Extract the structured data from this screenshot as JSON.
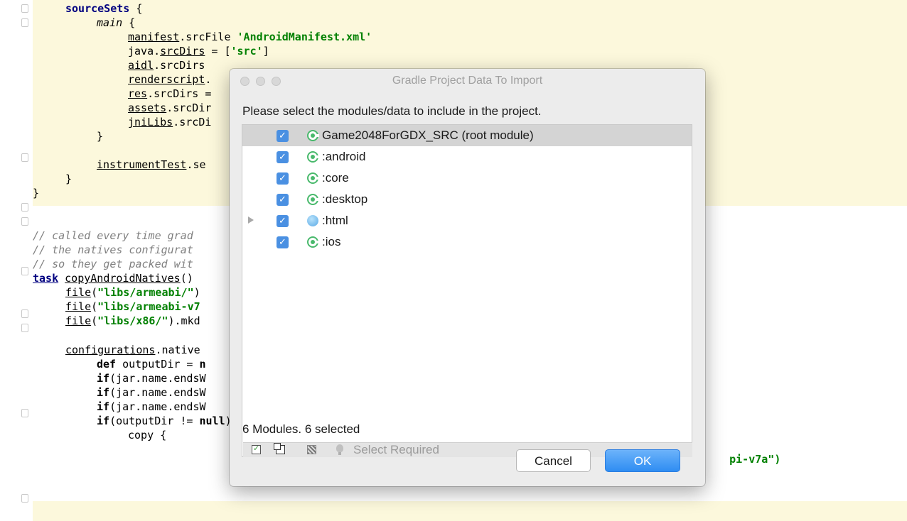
{
  "editor": {
    "lines": [
      {
        "segs": [
          {
            "t": "sourceSets",
            "c": "kw"
          },
          {
            "t": " {",
            "c": ""
          }
        ]
      },
      {
        "segs": [
          {
            "t": "main",
            "c": "it"
          },
          {
            "t": " {",
            "c": ""
          }
        ]
      },
      {
        "segs": [
          {
            "t": "manifest",
            "c": "ul"
          },
          {
            "t": ".srcFile ",
            "c": ""
          },
          {
            "t": "'AndroidManifest.xml'",
            "c": "str"
          }
        ]
      },
      {
        "segs": [
          {
            "t": "java.",
            "c": ""
          },
          {
            "t": "srcDirs",
            "c": "ul"
          },
          {
            "t": " = [",
            "c": ""
          },
          {
            "t": "'src'",
            "c": "str"
          },
          {
            "t": "]",
            "c": ""
          }
        ]
      },
      {
        "segs": [
          {
            "t": "aidl",
            "c": "ul"
          },
          {
            "t": ".srcDirs",
            "c": ""
          }
        ]
      },
      {
        "segs": [
          {
            "t": "renderscript",
            "c": "ul"
          },
          {
            "t": ".",
            "c": ""
          }
        ]
      },
      {
        "segs": [
          {
            "t": "res",
            "c": "ul"
          },
          {
            "t": ".srcDirs =",
            "c": ""
          }
        ]
      },
      {
        "segs": [
          {
            "t": "assets",
            "c": "ul"
          },
          {
            "t": ".srcDir",
            "c": ""
          }
        ]
      },
      {
        "segs": [
          {
            "t": "jniLibs",
            "c": "ul"
          },
          {
            "t": ".srcDi",
            "c": ""
          }
        ]
      },
      {
        "segs": [
          {
            "t": "}",
            "c": ""
          }
        ]
      },
      {
        "segs": []
      },
      {
        "segs": [
          {
            "t": "instrumentTest",
            "c": "ul"
          },
          {
            "t": ".se",
            "c": ""
          }
        ]
      },
      {
        "segs": [
          {
            "t": "}",
            "c": ""
          }
        ]
      },
      {
        "segs": [
          {
            "t": "}",
            "c": ""
          }
        ]
      },
      {
        "segs": []
      },
      {
        "segs": []
      },
      {
        "segs": [
          {
            "t": "// called every time grad",
            "c": "cm"
          }
        ]
      },
      {
        "segs": [
          {
            "t": "// the natives configurat",
            "c": "cm"
          }
        ]
      },
      {
        "segs": [
          {
            "t": "// so they get packed wit",
            "c": "cm"
          }
        ]
      },
      {
        "segs": [
          {
            "t": "task",
            "c": "kw ul"
          },
          {
            "t": " ",
            "c": ""
          },
          {
            "t": "copyAndroidNatives",
            "c": "ul"
          },
          {
            "t": "()",
            "c": ""
          }
        ]
      },
      {
        "segs": [
          {
            "t": "file",
            "c": "ul"
          },
          {
            "t": "(",
            "c": ""
          },
          {
            "t": "\"libs/armeabi/\"",
            "c": "str"
          },
          {
            "t": ")",
            "c": ""
          }
        ]
      },
      {
        "segs": [
          {
            "t": "file",
            "c": "ul"
          },
          {
            "t": "(",
            "c": ""
          },
          {
            "t": "\"libs/armeabi-v7",
            "c": "str"
          }
        ]
      },
      {
        "segs": [
          {
            "t": "file",
            "c": "ul"
          },
          {
            "t": "(",
            "c": ""
          },
          {
            "t": "\"libs/x86/\"",
            "c": "str"
          },
          {
            "t": ").mkd",
            "c": ""
          }
        ]
      },
      {
        "segs": []
      },
      {
        "segs": [
          {
            "t": "configurations",
            "c": "ul"
          },
          {
            "t": ".native",
            "c": ""
          }
        ]
      },
      {
        "segs": [
          {
            "t": "def",
            "c": "bold"
          },
          {
            "t": " outputDir = ",
            "c": ""
          },
          {
            "t": "n",
            "c": "bold"
          }
        ]
      },
      {
        "segs": [
          {
            "t": "if",
            "c": "bold"
          },
          {
            "t": "(jar.name.endsW",
            "c": ""
          }
        ]
      },
      {
        "segs": [
          {
            "t": "if",
            "c": "bold"
          },
          {
            "t": "(jar.name.endsW",
            "c": ""
          }
        ]
      },
      {
        "segs": [
          {
            "t": "if",
            "c": "bold"
          },
          {
            "t": "(jar.name.endsW",
            "c": ""
          }
        ]
      },
      {
        "segs": [
          {
            "t": "if",
            "c": "bold"
          },
          {
            "t": "(outputDir != ",
            "c": ""
          },
          {
            "t": "null",
            "c": "bold"
          },
          {
            "t": ") {",
            "c": ""
          }
        ]
      },
      {
        "segs": [
          {
            "t": "copy {",
            "c": ""
          }
        ]
      }
    ],
    "right_fragment": "pi-v7a\")"
  },
  "dialog": {
    "title": "Gradle Project Data To Import",
    "prompt": "Please select the modules/data to include in the project.",
    "modules": [
      {
        "label": "Game2048ForGDX_SRC (root module)",
        "checked": true,
        "icon": "module-icon",
        "selected": true
      },
      {
        "label": ":android",
        "checked": true,
        "icon": "module-icon"
      },
      {
        "label": ":core",
        "checked": true,
        "icon": "module-icon"
      },
      {
        "label": ":desktop",
        "checked": true,
        "icon": "module-icon"
      },
      {
        "label": ":html",
        "checked": true,
        "icon": "globe-icon",
        "expandable": true
      },
      {
        "label": ":ios",
        "checked": true,
        "icon": "module-icon"
      }
    ],
    "toolbar": {
      "select_required_label": "Select Required"
    },
    "status": "6 Modules. 6 selected",
    "cancel_label": "Cancel",
    "ok_label": "OK"
  }
}
